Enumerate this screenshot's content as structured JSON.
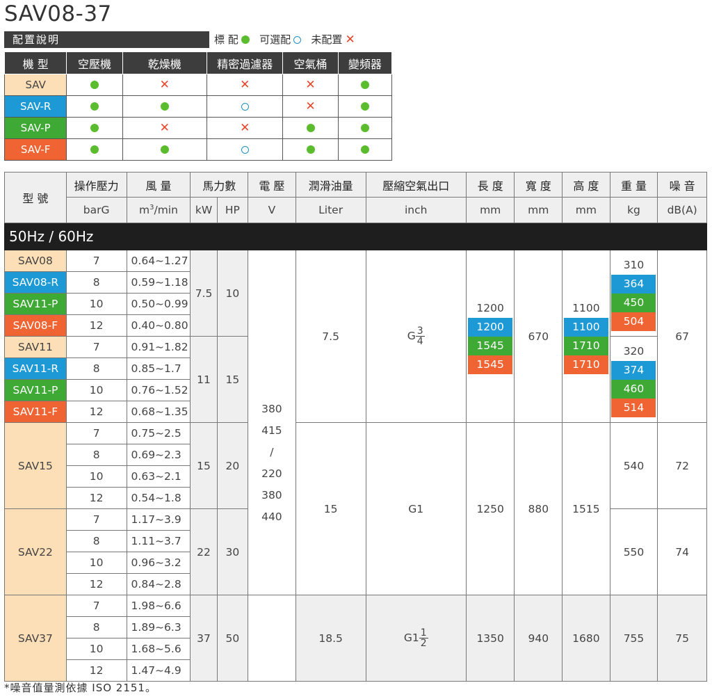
{
  "title": "SAV08-37",
  "config": {
    "bar_label": "配置說明",
    "legend": {
      "standard": "標 配",
      "optional": "可選配",
      "none": "未配置"
    },
    "headers": [
      "機 型",
      "空壓機",
      "乾燥機",
      "精密過濾器",
      "空氣桶",
      "變頻器"
    ],
    "rows": [
      {
        "model": "SAV",
        "color": "#fcdfb6",
        "marks": [
          "dot",
          "x",
          "x",
          "x",
          "dot"
        ]
      },
      {
        "model": "SAV-R",
        "color": "#1d9ad6",
        "marks": [
          "dot",
          "dot",
          "ring",
          "x",
          "dot"
        ]
      },
      {
        "model": "SAV-P",
        "color": "#3ea935",
        "marks": [
          "dot",
          "x",
          "x",
          "dot",
          "dot"
        ]
      },
      {
        "model": "SAV-F",
        "color": "#ef6432",
        "marks": [
          "dot",
          "dot",
          "ring",
          "dot",
          "dot"
        ]
      }
    ]
  },
  "spec": {
    "headers": {
      "model": "型 號",
      "pressure": "操作壓力",
      "flow": "風 量",
      "power": "馬力數",
      "voltage": "電 壓",
      "oil": "潤滑油量",
      "outlet": "壓縮空氣出口",
      "length": "長 度",
      "width": "寬 度",
      "height": "高 度",
      "weight": "重 量",
      "noise": "噪 音"
    },
    "units": {
      "pressure": "barG",
      "flow_prefix": "m",
      "flow_sup": "3",
      "flow_suffix": "/min",
      "kw": "kW",
      "hp": "HP",
      "voltage": "V",
      "oil": "Liter",
      "outlet": "inch",
      "length": "mm",
      "width": "mm",
      "height": "mm",
      "weight": "kg",
      "noise": "dB(A)"
    },
    "band": "50Hz / 60Hz",
    "sav08": {
      "models": [
        "SAV08",
        "SAV08-R",
        "SAV11-P",
        "SAV08-F"
      ],
      "pressures": [
        "7",
        "8",
        "10",
        "12"
      ],
      "flows": [
        "0.64~1.27",
        "0.59~1.18",
        "0.50~0.99",
        "0.40~0.80"
      ],
      "kw": "7.5",
      "hp": "10",
      "weights": [
        "310",
        "364",
        "450",
        "504"
      ]
    },
    "sav11": {
      "models": [
        "SAV11",
        "SAV11-R",
        "SAV11-P",
        "SAV11-F"
      ],
      "pressures": [
        "7",
        "8",
        "10",
        "12"
      ],
      "flows": [
        "0.91~1.82",
        "0.85~1.7",
        "0.76~1.52",
        "0.68~1.35"
      ],
      "kw": "11",
      "hp": "15",
      "weights": [
        "320",
        "374",
        "460",
        "514"
      ]
    },
    "small": {
      "oil": "7.5",
      "outlet_prefix": "G",
      "outlet_num": "3",
      "outlet_den": "4",
      "lengths": [
        "1200",
        "1200",
        "1545",
        "1545"
      ],
      "width": "670",
      "heights": [
        "1100",
        "1100",
        "1710",
        "1710"
      ],
      "noise": "67"
    },
    "voltage": [
      "380",
      "415",
      "/",
      "220",
      "380",
      "440"
    ],
    "sav15": {
      "model": "SAV15",
      "pressures": [
        "7",
        "8",
        "10",
        "12"
      ],
      "flows": [
        "0.75~2.5",
        "0.69~2.3",
        "0.63~2.1",
        "0.54~1.8"
      ],
      "kw": "15",
      "hp": "20",
      "weight": "540",
      "noise": "72"
    },
    "sav22": {
      "model": "SAV22",
      "pressures": [
        "7",
        "8",
        "10",
        "12"
      ],
      "flows": [
        "1.17~3.9",
        "1.11~3.7",
        "0.96~3.2",
        "0.84~2.8"
      ],
      "kw": "22",
      "hp": "30",
      "weight": "550",
      "noise": "74"
    },
    "mid": {
      "oil": "15",
      "outlet": "G1",
      "length": "1250",
      "width": "880",
      "height": "1515"
    },
    "sav37": {
      "model": "SAV37",
      "pressures": [
        "7",
        "8",
        "10",
        "12"
      ],
      "flows": [
        "1.98~6.6",
        "1.89~6.3",
        "1.68~5.6",
        "1.47~4.9"
      ],
      "kw": "37",
      "hp": "50",
      "oil": "18.5",
      "outlet_prefix": "G1",
      "outlet_num": "1",
      "outlet_den": "2",
      "length": "1350",
      "width": "940",
      "height": "1680",
      "weight": "755",
      "noise": "75"
    }
  },
  "footnote": "*噪音值量測依據 ISO 2151。"
}
